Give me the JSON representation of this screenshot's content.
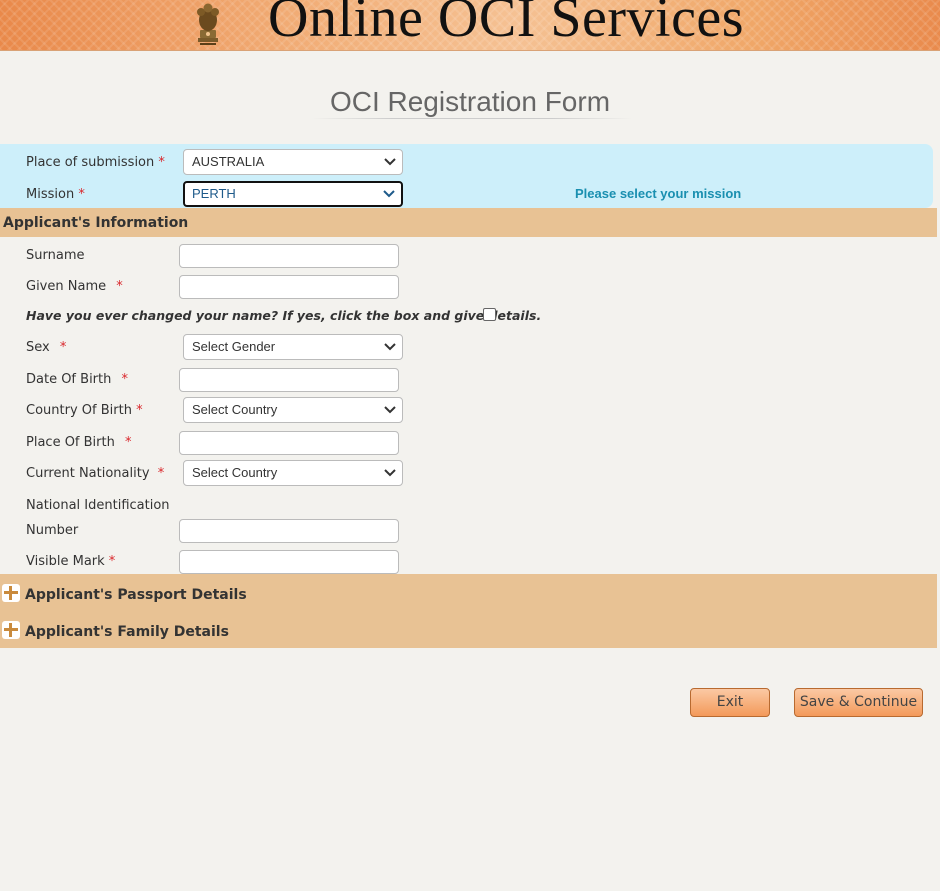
{
  "header": {
    "title": "Online OCI Services",
    "banner_color": "#f0a768"
  },
  "form": {
    "title": "OCI Registration Form"
  },
  "submission": {
    "place_label": "Place of submission",
    "place_value": "AUSTRALIA",
    "mission_label": "Mission",
    "mission_value": "PERTH",
    "mission_hint": "Please select your mission",
    "panel_color": "#cdeffa"
  },
  "applicant": {
    "section_title": "Applicant's Information",
    "surname_label": "Surname",
    "given_name_label": "Given Name",
    "name_change_question": "Have you ever changed your name? If yes, click the box and give details.",
    "sex_label": "Sex",
    "sex_value": "Select Gender",
    "dob_label": "Date Of Birth",
    "country_of_birth_label": "Country Of Birth",
    "country_of_birth_value": "Select Country",
    "place_of_birth_label": "Place Of Birth",
    "nationality_label": "Current Nationality",
    "nationality_value": "Select Country",
    "national_id_label_line1": "National Identification",
    "national_id_label_line2": "Number",
    "visible_mark_label": "Visible Mark",
    "required_marker": "*"
  },
  "collapsed_sections": {
    "passport": "Applicant's Passport Details",
    "family": "Applicant's Family Details"
  },
  "actions": {
    "exit_label": "Exit",
    "save_label": "Save & Continue"
  },
  "colors": {
    "section_bar": "#e8c294",
    "required": "#d9252a",
    "hint": "#1a8fb0",
    "button": "#f39a5a"
  }
}
